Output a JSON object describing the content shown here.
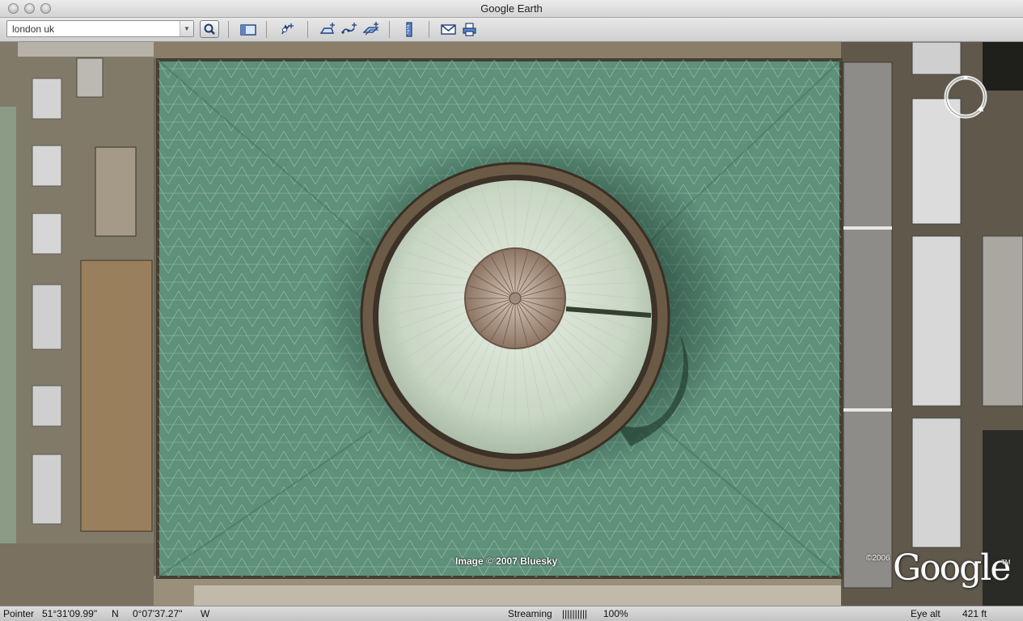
{
  "window": {
    "title": "Google Earth"
  },
  "toolbar": {
    "search_value": "london uk",
    "search_icon": "magnifier-icon",
    "buttons": [
      {
        "icon": "sidebar-toggle-icon"
      },
      {
        "icon": "add-placemark-icon"
      },
      {
        "icon": "add-polygon-icon"
      },
      {
        "icon": "add-path-icon"
      },
      {
        "icon": "add-image-overlay-icon"
      },
      {
        "icon": "ruler-icon"
      },
      {
        "icon": "email-icon"
      },
      {
        "icon": "print-icon"
      }
    ]
  },
  "map": {
    "credit": "Image © 2007 Bluesky",
    "copyright": "©2006",
    "logo": "Google",
    "trademark": "TM",
    "navigation_icon": "compass-ring-icon"
  },
  "status": {
    "pointer_label": "Pointer",
    "latitude": "51°31'09.99\"",
    "lat_dir": "N",
    "longitude": "0°07'37.27\"",
    "lon_dir": "W",
    "streaming_label": "Streaming",
    "streaming_bar": "||||||||||",
    "streaming_percent": "100%",
    "eye_alt_label": "Eye alt",
    "eye_alt_value": "421 ft"
  },
  "colors": {
    "roof": "#5e907a",
    "toolbar": "#d8d8d8"
  }
}
